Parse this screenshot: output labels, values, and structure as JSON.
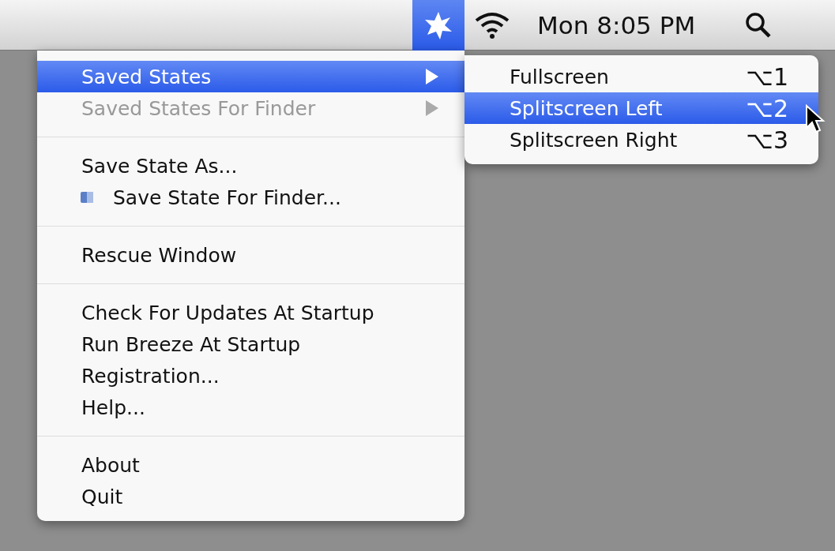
{
  "menu_bar": {
    "app_icon_selected": true,
    "clock": "Mon 8:05 PM"
  },
  "menu": {
    "groups": [
      [
        {
          "label": "Saved States",
          "kind": "submenu",
          "selected": true,
          "disabled": false
        },
        {
          "label": "Saved States For Finder",
          "kind": "submenu",
          "selected": false,
          "disabled": true
        }
      ],
      [
        {
          "label": "Save State As...",
          "kind": "item",
          "selected": false,
          "disabled": false
        },
        {
          "label": "Save State For Finder...",
          "kind": "icon-item",
          "selected": false,
          "disabled": false
        }
      ],
      [
        {
          "label": "Rescue Window",
          "kind": "item",
          "selected": false,
          "disabled": false
        }
      ],
      [
        {
          "label": "Check For Updates At Startup",
          "kind": "item",
          "selected": false,
          "disabled": false
        },
        {
          "label": "Run Breeze At Startup",
          "kind": "item",
          "selected": false,
          "disabled": false
        },
        {
          "label": "Registration...",
          "kind": "item",
          "selected": false,
          "disabled": false
        },
        {
          "label": "Help...",
          "kind": "item",
          "selected": false,
          "disabled": false
        }
      ],
      [
        {
          "label": "About",
          "kind": "item",
          "selected": false,
          "disabled": false
        },
        {
          "label": "Quit",
          "kind": "item",
          "selected": false,
          "disabled": false
        }
      ]
    ]
  },
  "submenu": {
    "items": [
      {
        "label": "Fullscreen",
        "shortcut": "⌥1",
        "selected": false
      },
      {
        "label": "Splitscreen Left",
        "shortcut": "⌥2",
        "selected": true
      },
      {
        "label": "Splitscreen Right",
        "shortcut": "⌥3",
        "selected": false
      }
    ]
  }
}
